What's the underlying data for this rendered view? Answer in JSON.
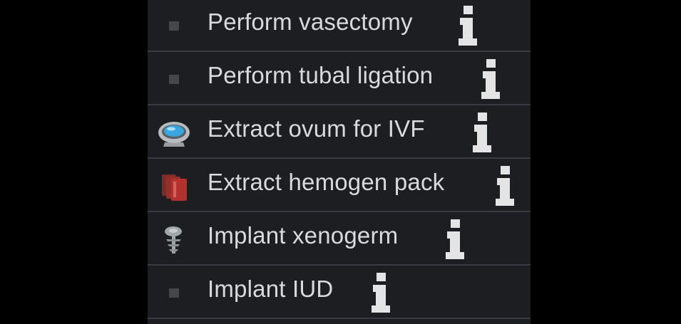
{
  "operations": [
    {
      "label": "Perform vasectomy",
      "icon": "bullet-icon",
      "info_icon": "info-icon"
    },
    {
      "label": "Perform tubal ligation",
      "icon": "bullet-icon",
      "info_icon": "info-icon"
    },
    {
      "label": "Extract ovum for IVF",
      "icon": "ovum-capsule-icon",
      "info_icon": "info-icon"
    },
    {
      "label": "Extract hemogen pack",
      "icon": "hemogen-pack-icon",
      "info_icon": "info-icon"
    },
    {
      "label": "Implant xenogerm",
      "icon": "xenogerm-icon",
      "info_icon": "info-icon"
    },
    {
      "label": "Implant IUD",
      "icon": "bullet-icon",
      "info_icon": "info-icon"
    }
  ],
  "colors": {
    "panel_bg": "#1c1e22",
    "divider": "#3a3c41",
    "text": "#d9dadc",
    "info_icon": "#e4e4e4",
    "ovum_accent": "#3aa6e0",
    "hemogen_accent": "#b3322f"
  }
}
